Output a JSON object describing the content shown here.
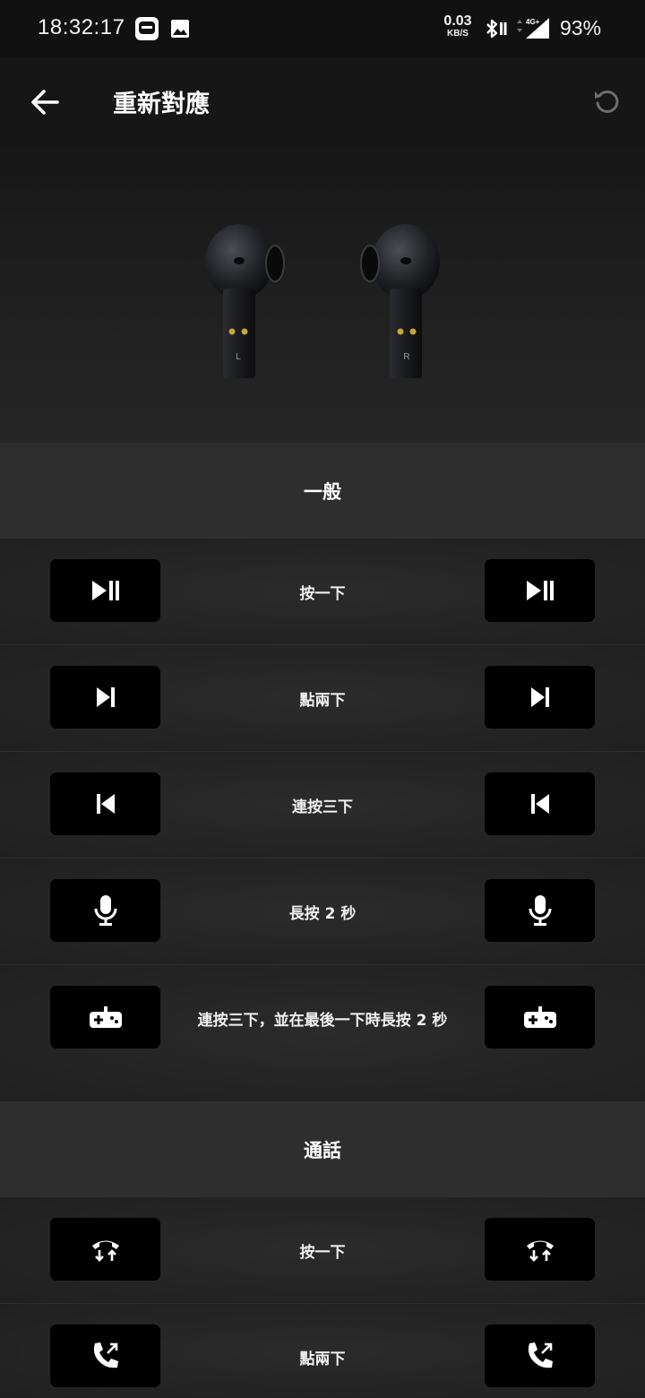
{
  "status_bar": {
    "time": "18:32:17",
    "net_speed": "0.03",
    "net_unit": "KB/S",
    "battery": "93%",
    "icons": [
      "app-notification-icon",
      "image-icon",
      "bluetooth-icon",
      "data-arrows-icon",
      "signal-4g-icon"
    ]
  },
  "app_bar": {
    "title": "重新對應",
    "back_icon": "arrow-left-icon",
    "reset_icon": "reset-icon"
  },
  "hero": {
    "left_label": "L",
    "right_label": "R"
  },
  "sections": [
    {
      "title": "一般",
      "rows": [
        {
          "label": "按一下",
          "icon": "play-pause-icon"
        },
        {
          "label": "點兩下",
          "icon": "next-track-icon"
        },
        {
          "label": "連按三下",
          "icon": "previous-track-icon"
        },
        {
          "label": "長按 2 秒",
          "icon": "microphone-icon"
        },
        {
          "label": "連按三下，並在最後一下時長按 2 秒",
          "icon": "gamepad-icon"
        }
      ]
    },
    {
      "title": "通話",
      "rows": [
        {
          "label": "按一下",
          "icon": "answer-hangup-icon"
        },
        {
          "label": "點兩下",
          "icon": "call-transfer-icon"
        }
      ]
    }
  ],
  "colors": {
    "background": "#1c1c1c",
    "section_header": "#2e2e2e",
    "button": "#000000",
    "text": "#ffffff"
  }
}
